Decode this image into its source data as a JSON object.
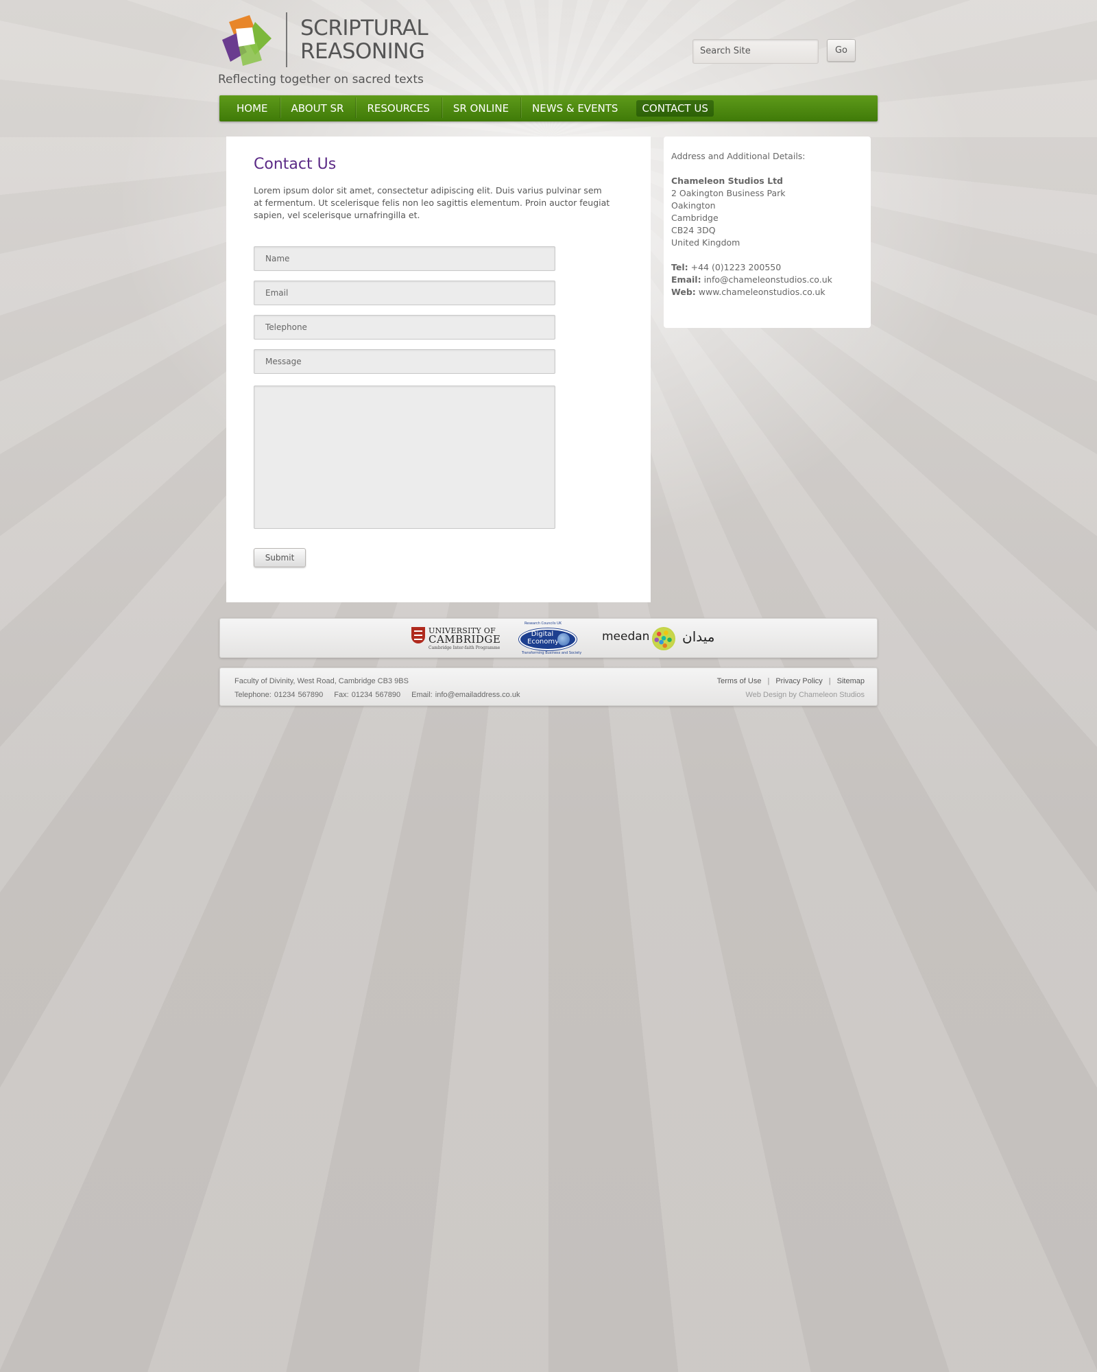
{
  "header": {
    "logo_text_line1": "SCRIPTURAL",
    "logo_text_line2": "REASONING",
    "tagline": "Reflecting together on sacred texts",
    "search_placeholder": "Search Site",
    "go_label": "Go"
  },
  "nav": {
    "items": [
      {
        "label": "HOME"
      },
      {
        "label": "ABOUT SR"
      },
      {
        "label": "RESOURCES"
      },
      {
        "label": "SR ONLINE"
      },
      {
        "label": "NEWS & EVENTS"
      },
      {
        "label": "CONTACT US"
      }
    ],
    "active": "CONTACT US"
  },
  "main": {
    "title": "Contact Us",
    "intro": "Lorem ipsum dolor sit amet, consectetur adipiscing elit. Duis varius pulvinar sem at fermentum. Ut scelerisque felis non leo sagittis elementum. Proin auctor feugiat sapien, vel scelerisque urnafringilla et.",
    "form": {
      "name_placeholder": "Name",
      "email_placeholder": "Email",
      "telephone_placeholder": "Telephone",
      "message_placeholder": "Message",
      "submit_label": "Submit"
    }
  },
  "sidebar": {
    "heading": "Address and Additional Details:",
    "company": "Chameleon Studios Ltd",
    "address": [
      "2 Oakington Business Park",
      "Oakington",
      "Cambridge",
      "CB24 3DQ",
      "United Kingdom"
    ],
    "tel_label": "Tel:",
    "tel": "+44 (0)1223 200550",
    "email_label": "Email:",
    "email": "info@chameleonstudios.co.uk",
    "web_label": "Web:",
    "web": "www.chameleonstudios.co.uk"
  },
  "partners": {
    "cambridge_line1": "UNIVERSITY OF",
    "cambridge_line2": "CAMBRIDGE",
    "cambridge_line3": "Cambridge Inter-faith Programme",
    "digital_top": "Research Councils UK",
    "digital_line1": "Digital",
    "digital_line2": "Economy",
    "digital_bottom": "Transforming Business and Society",
    "meedan": "meedan",
    "meedan_arabic": "ميدان"
  },
  "footer": {
    "address": "Faculty of Divinity, West Road, Cambridge CB3 9BS",
    "telephone": "Telephone: 01234 567890",
    "fax": "Fax: 01234 567890",
    "email": "Email: info@emailaddress.co.uk",
    "links": [
      "Terms of Use",
      "Privacy Policy",
      "Sitemap"
    ],
    "credit": "Web Design by Chameleon Studios"
  },
  "colors": {
    "nav_green": "#4a8a10",
    "title_purple": "#5b2a86"
  }
}
